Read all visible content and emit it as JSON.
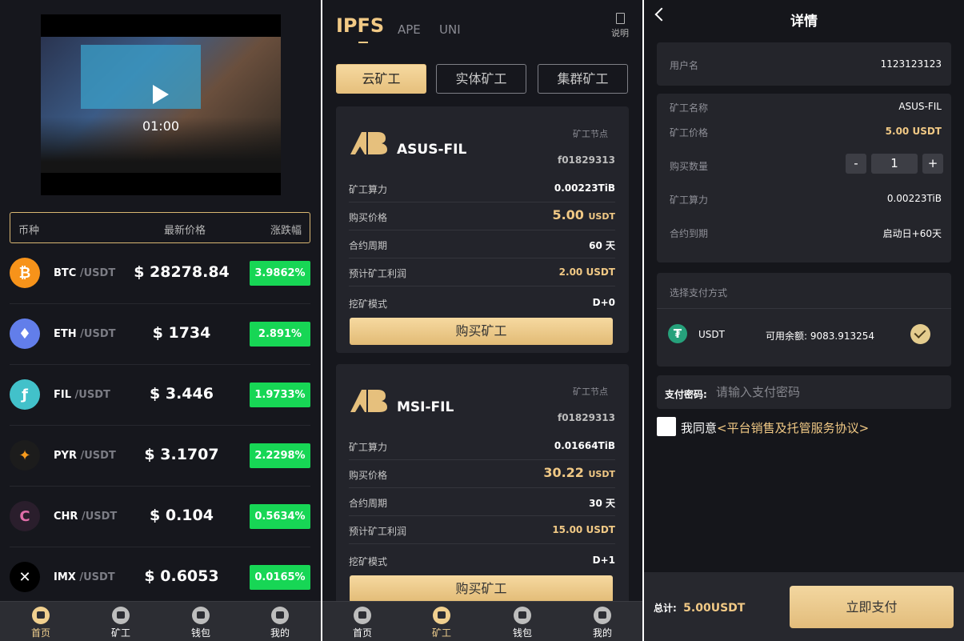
{
  "market": {
    "video_time": "01:00",
    "head": {
      "coin": "币种",
      "price": "最新价格",
      "change": "涨跌幅"
    },
    "quote_suffix": "/USDT",
    "rows": [
      {
        "symbol": "BTC",
        "price": "$ 28278.84",
        "change": "3.9862%",
        "icon": "bitcoin-icon",
        "color": "#f7931a",
        "glyph": "₿"
      },
      {
        "symbol": "ETH",
        "price": "$ 1734",
        "change": "2.891%",
        "icon": "ethereum-icon",
        "color": "#627eea",
        "glyph": "♦"
      },
      {
        "symbol": "FIL",
        "price": "$ 3.446",
        "change": "1.9733%",
        "icon": "filecoin-icon",
        "color": "#42c1ca",
        "glyph": "ƒ"
      },
      {
        "symbol": "PYR",
        "price": "$ 3.1707",
        "change": "2.2298%",
        "icon": "vulcan-icon",
        "color": "#1c1c1c",
        "glyph": "✦"
      },
      {
        "symbol": "CHR",
        "price": "$ 0.104",
        "change": "0.5634%",
        "icon": "chromia-icon",
        "color": "#2a1e2c",
        "glyph": "C"
      },
      {
        "symbol": "IMX",
        "price": "$ 0.6053",
        "change": "0.0165%",
        "icon": "immutable-icon",
        "color": "#000000",
        "glyph": "✕"
      }
    ],
    "tabs": [
      "首页",
      "矿工",
      "钱包",
      "我的"
    ]
  },
  "miners": {
    "top_tabs": [
      "IPFS",
      "APE",
      "UNI"
    ],
    "doc_label": "说明",
    "segments": [
      "云矿工",
      "实体矿工",
      "集群矿工"
    ],
    "node_label": "矿工节点",
    "labels": {
      "power": "矿工算力",
      "price": "购买价格",
      "period": "合约周期",
      "profit": "预计矿工利润",
      "mode": "挖矿模式"
    },
    "buy_label": "购买矿工",
    "cards": [
      {
        "name": "ASUS-FIL",
        "node": "f01829313",
        "power": "0.00223TiB",
        "price": "5.00",
        "price_unit": "USDT",
        "period": "60 天",
        "profit": "2.00 USDT",
        "mode": "D+0"
      },
      {
        "name": "MSI-FIL",
        "node": "f01829313",
        "power": "0.01664TiB",
        "price": "30.22",
        "price_unit": "USDT",
        "period": "30 天",
        "profit": "15.00 USDT",
        "mode": "D+1"
      }
    ],
    "tabs": [
      "首页",
      "矿工",
      "钱包",
      "我的"
    ]
  },
  "detail": {
    "title": "详情",
    "user_label": "用户名",
    "user_value": "1123123123",
    "name_label": "矿工名称",
    "name_value": "ASUS-FIL",
    "price_label": "矿工价格",
    "price_value": "5.00 USDT",
    "qty_label": "购买数量",
    "qty_minus": "-",
    "qty_value": "1",
    "qty_plus": "+",
    "power_label": "矿工算力",
    "power_value": "0.00223TiB",
    "expire_label": "合约到期",
    "expire_value": "启动日+60天",
    "pay_method_label": "选择支付方式",
    "pay_coin": "USDT",
    "balance": "可用余额: 9083.913254",
    "pw_label": "支付密码:",
    "pw_placeholder": "请输入支付密码",
    "agree_text": "我同意",
    "agree_link": "<平台销售及托管服务协议>",
    "total_label": "总计:",
    "total_value": "5.00USDT",
    "pay_button": "立即支付"
  },
  "colors": {
    "accent": "#f1c985",
    "up": "#17d655",
    "bg": "#16171d"
  }
}
